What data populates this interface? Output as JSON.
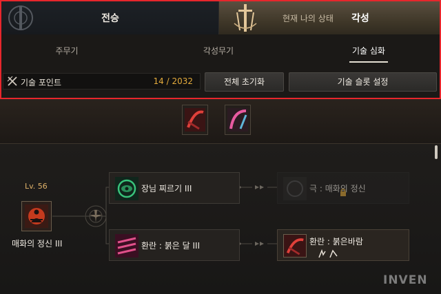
{
  "top_tabs": {
    "left_label": "전승",
    "right_sub": "현재 나의 상태",
    "right_label": "각성"
  },
  "sub_tabs": {
    "main_weapon": "주무기",
    "awaken_weapon": "각성무기",
    "skill_enhance": "기술 심화"
  },
  "points": {
    "label": "기술 포인트",
    "value": "14 / 2032"
  },
  "buttons": {
    "reset_all": "전체 초기화",
    "slot_settings": "기술 슬롯 설정"
  },
  "tree": {
    "level": "Lv. 56",
    "root_name": "매화의 정신 III",
    "node_top": "장님 찌르기 III",
    "node_locked": "극 : 매화의 정신",
    "node_bottom": "환란 : 붉은 달 III",
    "node_result": "환란 : 붉은바람"
  },
  "colors": {
    "points_value": "#e4ab3c",
    "highlight_border": "#e8262c",
    "level_text": "#e0b36a"
  },
  "icons": [
    "emblem-icon",
    "awakening-emblem-icon",
    "skill-point-icon",
    "lock-icon"
  ],
  "watermark": "INVEN"
}
